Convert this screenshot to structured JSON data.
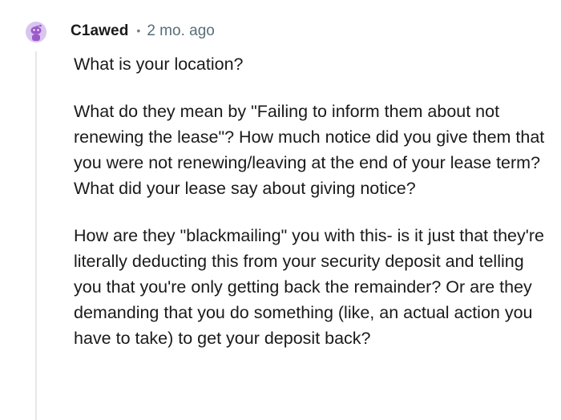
{
  "comment": {
    "author": "C1awed",
    "separator": "•",
    "timestamp": "2 mo. ago",
    "paragraphs": [
      "What is your location?",
      "What do they mean by \"Failing to inform them about not renewing the lease\"? How much notice did you give them that you were not renewing/leaving at the end of your lease term? What did your lease say about giving notice?",
      "How are they \"blackmailing\" you with this- is it just that they're literally deducting this from your security deposit and telling you that you're only getting back the remainder? Or are they demanding that you do something (like, an actual action you have to take) to get your deposit back?"
    ]
  },
  "colors": {
    "avatar_bg": "#d9c6f0",
    "avatar_figure": "#9b59c9",
    "thread_line": "#e5e7eb",
    "meta_text": "#576f76"
  }
}
